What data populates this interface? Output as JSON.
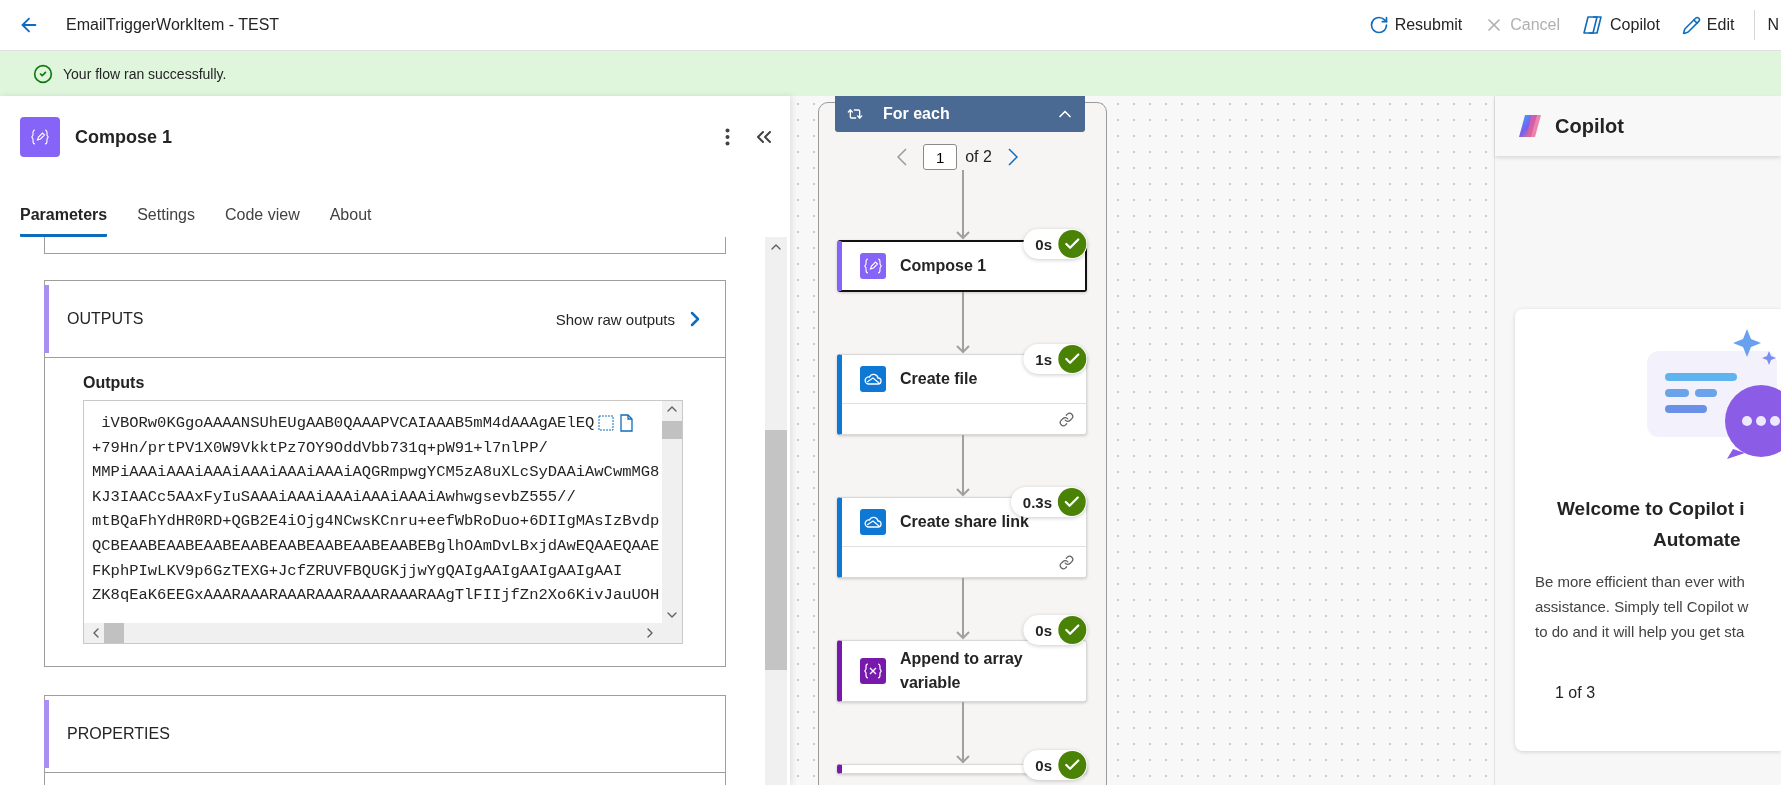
{
  "header": {
    "title": "EmailTriggerWorkItem - TEST",
    "actions": [
      {
        "label": "Resubmit",
        "kind": "refresh",
        "disabled": false
      },
      {
        "label": "Cancel",
        "kind": "close",
        "disabled": true
      },
      {
        "label": "Copilot",
        "kind": "copilot",
        "disabled": false
      },
      {
        "label": "Edit",
        "kind": "pencil",
        "disabled": false
      },
      {
        "label": "N",
        "kind": "plain",
        "disabled": false
      }
    ]
  },
  "banner": {
    "message": "Your flow ran successfully."
  },
  "panel": {
    "title": "Compose 1",
    "tabs": [
      {
        "label": "Parameters",
        "selected": true
      },
      {
        "label": "Settings",
        "selected": false
      },
      {
        "label": "Code view",
        "selected": false
      },
      {
        "label": "About",
        "selected": false
      }
    ],
    "outputs": {
      "title": "OUTPUTS",
      "link": "Show raw outputs",
      "field_label": "Outputs",
      "lines": [
        " iVBORw0KGgoAAAANSUhEUgAAB0QAAAPVCAIAAAB5mM4dAAAgAElEQ",
        "+79Hn/prtPV1X0W9VkktPz7OY9OddVbb731q+pW91+l7nlPP/",
        "MMPiAAAiAAAiAAAiAAAiAAAiAAAiAQGRmpwgYCM5zA8uXLcSyDAAiAwCwmMG8",
        "KJ3IAACc5AAxFyIuSAAAiAAAiAAAiAAAiAAAiAwhwgsevbZ555//",
        "mtBQaFhYdHR0RD+QGB2E4iOjg4NCwsKCnru+eefWbRoDuo+6DIIgMAsIzBvdp",
        "QCBEAABEAABEAABEAABEAABEAABEAABEAABEBglhOAmDvLBxjdAwEQAAEQAAE",
        "FKphPIwLKV9p6GzTEXG+JcfZRUVFBQUGKjjwYgQAIgAAIgAAIgAAIgAAI",
        "ZK8qEaK6EEGxAAARAAARAAARAAARAAARAAARAAgTlFIIjfZn2Xo6KivJauUOH"
      ]
    },
    "properties": {
      "title": "PROPERTIES"
    }
  },
  "flow": {
    "loop": {
      "title": "For each",
      "page": "1",
      "of": "of 2"
    },
    "steps": [
      {
        "title": "Compose 1",
        "kind": "compose",
        "duration": "0s",
        "selected": true,
        "link_footer": false
      },
      {
        "title": "Create file",
        "kind": "onedrive",
        "duration": "1s",
        "selected": false,
        "link_footer": true
      },
      {
        "title": "Create share link",
        "kind": "onedrive",
        "duration": "0.3s",
        "selected": false,
        "link_footer": true
      },
      {
        "title": "Append to array variable",
        "kind": "variable",
        "duration": "0s",
        "selected": false,
        "link_footer": false
      },
      {
        "kind": "variable",
        "duration": "0s",
        "selected": false,
        "link_footer": false
      }
    ]
  },
  "copilot": {
    "title": "Copilot",
    "heading_lines": [
      "Welcome to Copilot i",
      "Automate"
    ],
    "body_lines": [
      "Be more efficient than ever with",
      "assistance. Simply tell Copilot w",
      "to do and it will help you get sta"
    ],
    "pager": "1 of 3"
  }
}
